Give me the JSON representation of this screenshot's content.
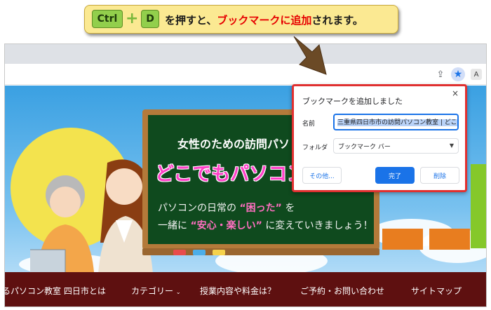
{
  "callout": {
    "key_ctrl": "Ctrl",
    "key_plus": "+",
    "key_d": "D",
    "text_before": "を押すと、",
    "text_highlight": "ブックマークに追加",
    "text_after": "されます。"
  },
  "browser": {
    "toolbar_icons": [
      "share-icon",
      "star-icon",
      "extension-icon"
    ]
  },
  "site": {
    "chalkboard_title": "女性のための訪問パソ",
    "chalkboard_main": "どこでもパソコン教",
    "line1_pre": "パソコンの日常の",
    "line1_quote": "“困った”",
    "line1_post": "を",
    "line2_pre": "一緒に",
    "line2_quote": "“安心・楽しい”",
    "line2_post": "に変えていきましょう！",
    "nav": [
      "るパソコン教室 四日市とは",
      "カテゴリー",
      "授業内容や料金は？",
      "ご予約・お問い合わせ",
      "サイトマップ"
    ]
  },
  "dialog": {
    "title": "ブックマークを追加しました",
    "name_label": "名前",
    "name_value": "三重県四日市市の訪問パソコン教室 | どこでも",
    "folder_label": "フォルダ",
    "folder_value": "ブックマーク バー",
    "btn_more": "その他...",
    "btn_done": "完了",
    "btn_remove": "削除",
    "close": "×"
  },
  "colors": {
    "accent": "#1a73e8",
    "highlight_border": "#e03030",
    "callout_bg": "#fbe992",
    "nav_bg": "#5e1010"
  }
}
